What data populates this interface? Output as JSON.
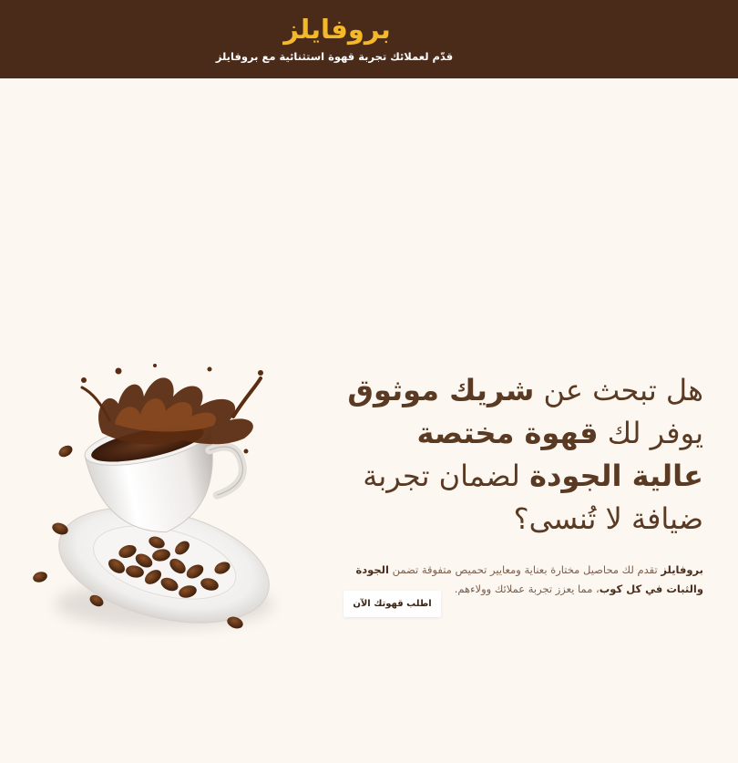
{
  "header": {
    "brand": "بروفايلز",
    "tagline": "قدّم لعملائك تجربة قهوة استثنائية مع بروفايلز"
  },
  "hero": {
    "headline": {
      "part1": "هل تبحث عن ",
      "part2": "شريك موثوق",
      "part3": " يوفر لك ",
      "part4": "قهوة مختصة عالية الجودة",
      "part5": " لضمان تجربة ضيافة لا تُنسى؟"
    },
    "description": {
      "brand": "بروفايلز",
      "text1": " تقدم لك محاصيل مختارة بعناية ومعايير تحميص متفوقة تضمن ",
      "highlight": "الجودة والثبات في كل كوب",
      "text2": "، مما يعزز تجربة عملائك وولاءهم."
    },
    "cta_label": "اطلب قهوتك الآن",
    "image_icon": "coffee-cup-splash-illustration"
  },
  "colors": {
    "header_bg": "#4a2b1a",
    "brand": "#f3b92a",
    "page_bg": "#fdf7f2",
    "headline": "#5a3a22"
  }
}
